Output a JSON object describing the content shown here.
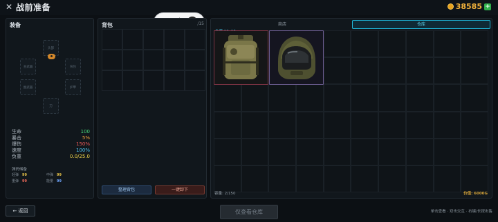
{
  "header": {
    "title": "战前准备",
    "close_icon": "close-icon",
    "coins": "38585",
    "coin_icon": "gold-coin-icon",
    "add_icon": "plus-icon"
  },
  "equipment": {
    "title": "装备",
    "slots": {
      "head": "头部",
      "main_weapon": "主武器",
      "backpack": "背包",
      "secondary_weapon": "副武器",
      "armor": "护甲",
      "melee": "刀"
    },
    "stats": [
      {
        "label": "生命",
        "value": "100",
        "color": "#49d77a"
      },
      {
        "label": "暴击",
        "value": "5%",
        "color": "#f0a23b"
      },
      {
        "label": "爆伤",
        "value": "150%",
        "color": "#ef5b5b"
      },
      {
        "label": "速度",
        "value": "100%",
        "color": "#4fc3f0"
      },
      {
        "label": "负重",
        "value": "0.0/25.0",
        "color": "#f0d54a"
      }
    ],
    "ammo_title": "弹药储备",
    "ammo": [
      {
        "label": "轻弹",
        "value": "99",
        "color": "#e8c449"
      },
      {
        "label": "中弹",
        "value": "99",
        "color": "#e8c449"
      },
      {
        "label": "重弹",
        "value": "99",
        "color": "#ef6a5a"
      },
      {
        "label": "能量",
        "value": "99",
        "color": "#6fa6ff"
      }
    ]
  },
  "backpack": {
    "title": "背包",
    "count": "/15",
    "sort_button": "整理背包",
    "unload_button": "一键卸下"
  },
  "storage": {
    "tab_shop": "商店",
    "tab_storage": "仓库",
    "grid_label": "仓库 10x15",
    "items": [
      {
        "name": "camo-backpack",
        "icon": "backpack-icon"
      },
      {
        "name": "tactical-helmet",
        "icon": "helmet-icon"
      }
    ],
    "capacity": "容量: 2/150",
    "value": "价值: 6000G"
  },
  "footer": {
    "back_button": "← 返回",
    "view_only": "仅查看仓库",
    "hint": "单击查看 · 双击交互 · 右键/长按出售"
  },
  "wechat_capsule": {
    "menu_icon": "more-dots-icon",
    "close_icon": "target-circle-icon"
  }
}
